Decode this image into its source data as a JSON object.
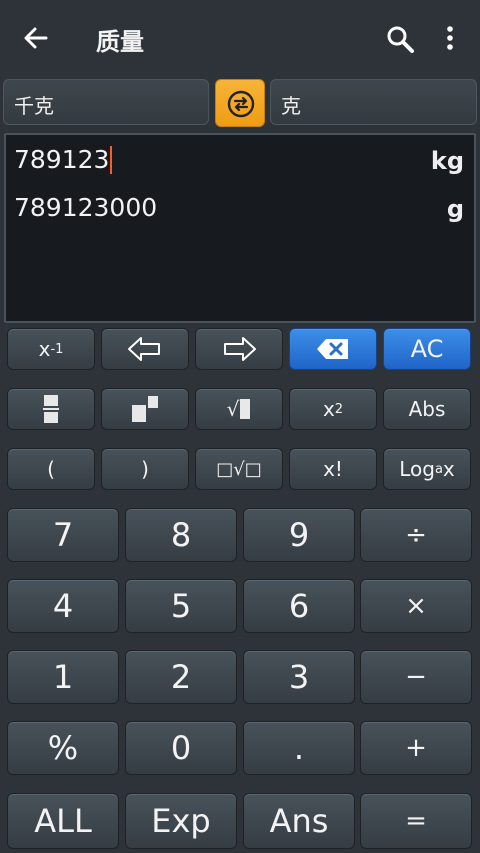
{
  "header": {
    "title": "质量",
    "back_icon": "arrow-left-icon",
    "search_icon": "search-icon",
    "menu_icon": "more-vertical-icon"
  },
  "units": {
    "from": "千克",
    "to": "克",
    "swap_icon": "swap-icon",
    "accent": "#f5a623"
  },
  "display": {
    "input_value": "789123",
    "input_unit": "kg",
    "output_value": "789123000",
    "output_unit": "g"
  },
  "keys": {
    "row1": {
      "inverse": "x",
      "inverse_sup": "-1",
      "left_icon": "arrow-left-outline-icon",
      "right_icon": "arrow-right-outline-icon",
      "backspace_icon": "backspace-icon",
      "clear": "AC"
    },
    "row2": {
      "fraction_icon": "fraction-icon",
      "power_icon": "power-icon",
      "sqrt": "√",
      "square": "x",
      "square_sup": "2",
      "abs": "Abs"
    },
    "row3": {
      "open_paren": "(",
      "close_paren": ")",
      "nth_root": "□√□",
      "factorial": "x!",
      "log": "Log",
      "log_sub": "a",
      "log_x": "x"
    },
    "numpad": [
      [
        "7",
        "8",
        "9",
        "÷"
      ],
      [
        "4",
        "5",
        "6",
        "×"
      ],
      [
        "1",
        "2",
        "3",
        "−"
      ],
      [
        "%",
        "0",
        ".",
        "+"
      ],
      [
        "ALL",
        "Exp",
        "Ans",
        "="
      ]
    ]
  }
}
